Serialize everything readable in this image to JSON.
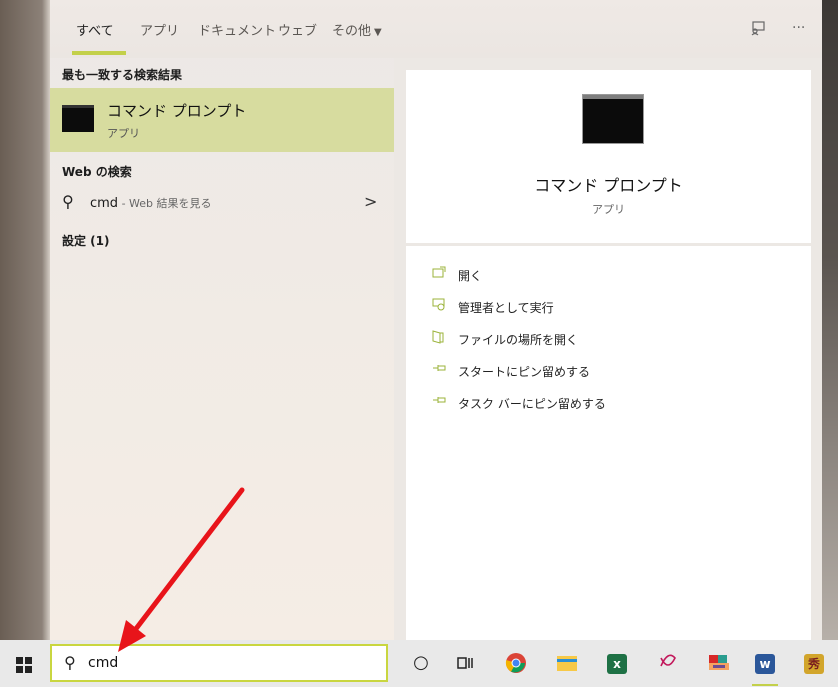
{
  "tabs": [
    {
      "label": "すべて"
    },
    {
      "label": "アプリ"
    },
    {
      "label": "ドキュメント"
    },
    {
      "label": "ウェブ"
    },
    {
      "label": "その他"
    }
  ],
  "header_icons": {
    "feedback": "feedback-icon",
    "more": "···"
  },
  "best_match": {
    "heading": "最も一致する検索結果",
    "title": "コマンド プロンプト",
    "subtitle": "アプリ"
  },
  "web_search": {
    "heading": "Web の検索",
    "query": "cmd",
    "hint": " - Web 結果を見る"
  },
  "settings": {
    "heading": "設定 (1)"
  },
  "detail": {
    "title": "コマンド プロンプト",
    "subtitle": "アプリ",
    "actions": [
      {
        "label": "開く",
        "icon": "open-icon"
      },
      {
        "label": "管理者として実行",
        "icon": "run-as-admin-icon"
      },
      {
        "label": "ファイルの場所を開く",
        "icon": "file-location-icon"
      },
      {
        "label": "スタートにピン留めする",
        "icon": "pin-icon"
      },
      {
        "label": "タスク バーにピン留めする",
        "icon": "pin-icon"
      }
    ]
  },
  "taskbar": {
    "search_value": "cmd",
    "apps": [
      "cortana-icon",
      "task-view-icon",
      "chrome-icon",
      "file-explorer-icon",
      "excel-icon",
      "app-icon",
      "app-icon",
      "word-icon",
      "app-icon"
    ]
  },
  "colors": {
    "accent": "#c3d04a",
    "selected": "#d7dc9f",
    "arrow": "#e8141a"
  }
}
